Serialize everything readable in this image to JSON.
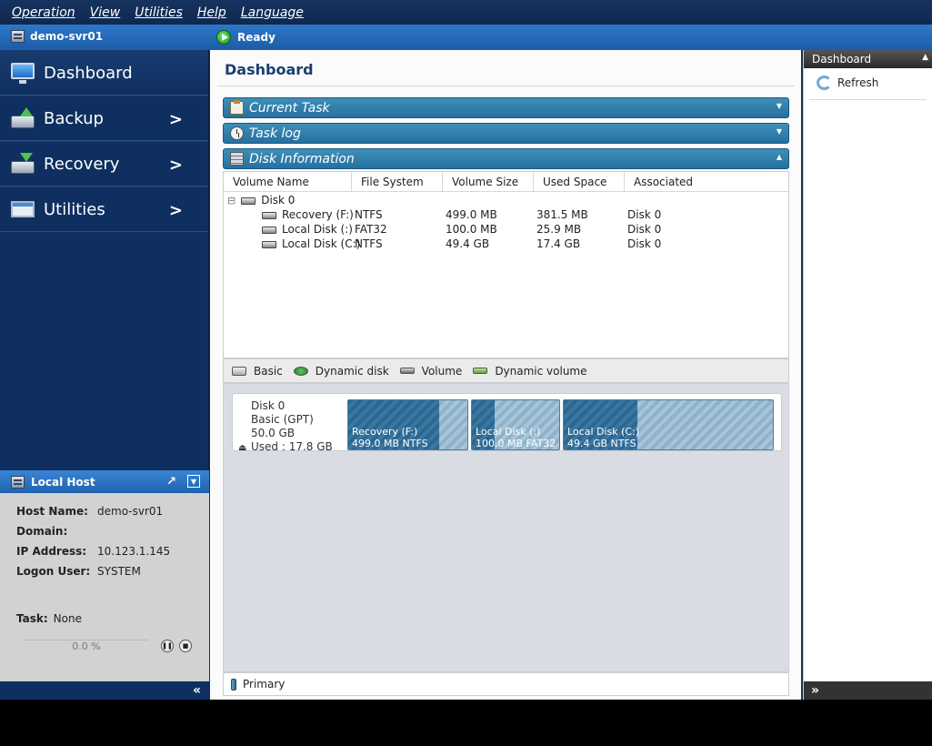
{
  "menu": [
    "Operation",
    "View",
    "Utilities",
    "Help",
    "Language"
  ],
  "status": {
    "host": "demo-svr01",
    "state": "Ready"
  },
  "nav": [
    {
      "label": "Dashboard"
    },
    {
      "label": "Backup",
      "chevron": ">"
    },
    {
      "label": "Recovery",
      "chevron": ">"
    },
    {
      "label": "Utilities",
      "chevron": ">"
    }
  ],
  "local_host": {
    "title": "Local Host",
    "host_name_label": "Host Name:",
    "host_name": "demo-svr01",
    "domain_label": "Domain:",
    "domain": "",
    "ip_label": "IP Address:",
    "ip": "10.123.1.145",
    "logon_label": "Logon User:",
    "logon": "SYSTEM",
    "task_label": "Task:",
    "task": "None",
    "progress": "0.0 %",
    "collapse": "«"
  },
  "main": {
    "title": "Dashboard",
    "sections": [
      "Current Task",
      "Task log",
      "Disk Information"
    ],
    "columns": [
      "Volume Name",
      "File System",
      "Volume Size",
      "Used Space",
      "Associated"
    ],
    "disk": {
      "expander": "⊟",
      "name": "Disk 0"
    },
    "volumes": [
      {
        "name": "Recovery (F:)",
        "fs": "NTFS",
        "size": "499.0 MB",
        "used": "381.5 MB",
        "assoc": "Disk 0"
      },
      {
        "name": "Local Disk (:)",
        "fs": "FAT32",
        "size": "100.0 MB",
        "used": "25.9 MB",
        "assoc": "Disk 0"
      },
      {
        "name": "Local Disk (C:)",
        "fs": "NTFS",
        "size": "49.4 GB",
        "used": "17.4 GB",
        "assoc": "Disk 0"
      }
    ],
    "legend": [
      "Basic",
      "Dynamic disk",
      "Volume",
      "Dynamic volume"
    ],
    "map": {
      "disk_name": "Disk 0",
      "disk_type": "Basic (GPT)",
      "disk_size": "50.0 GB",
      "disk_used": "Used : 17.8 GB",
      "partitions": [
        {
          "label": "Recovery (F:)",
          "detail": "499.0 MB NTFS",
          "used_fraction": 0.76
        },
        {
          "label": "Local Disk (:)",
          "detail": "100.0 MB FAT32",
          "used_fraction": 0.26
        },
        {
          "label": "Local Disk (C:)",
          "detail": "49.4 GB NTFS",
          "used_fraction": 0.35
        }
      ]
    },
    "footer_legend": "Primary"
  },
  "right_panel": {
    "title": "Dashboard",
    "refresh": "Refresh",
    "expand": "»"
  },
  "colors": {
    "accent": "#2670a0",
    "nav_bg": "#0f2f60",
    "status_bar": "#2e78c8"
  }
}
